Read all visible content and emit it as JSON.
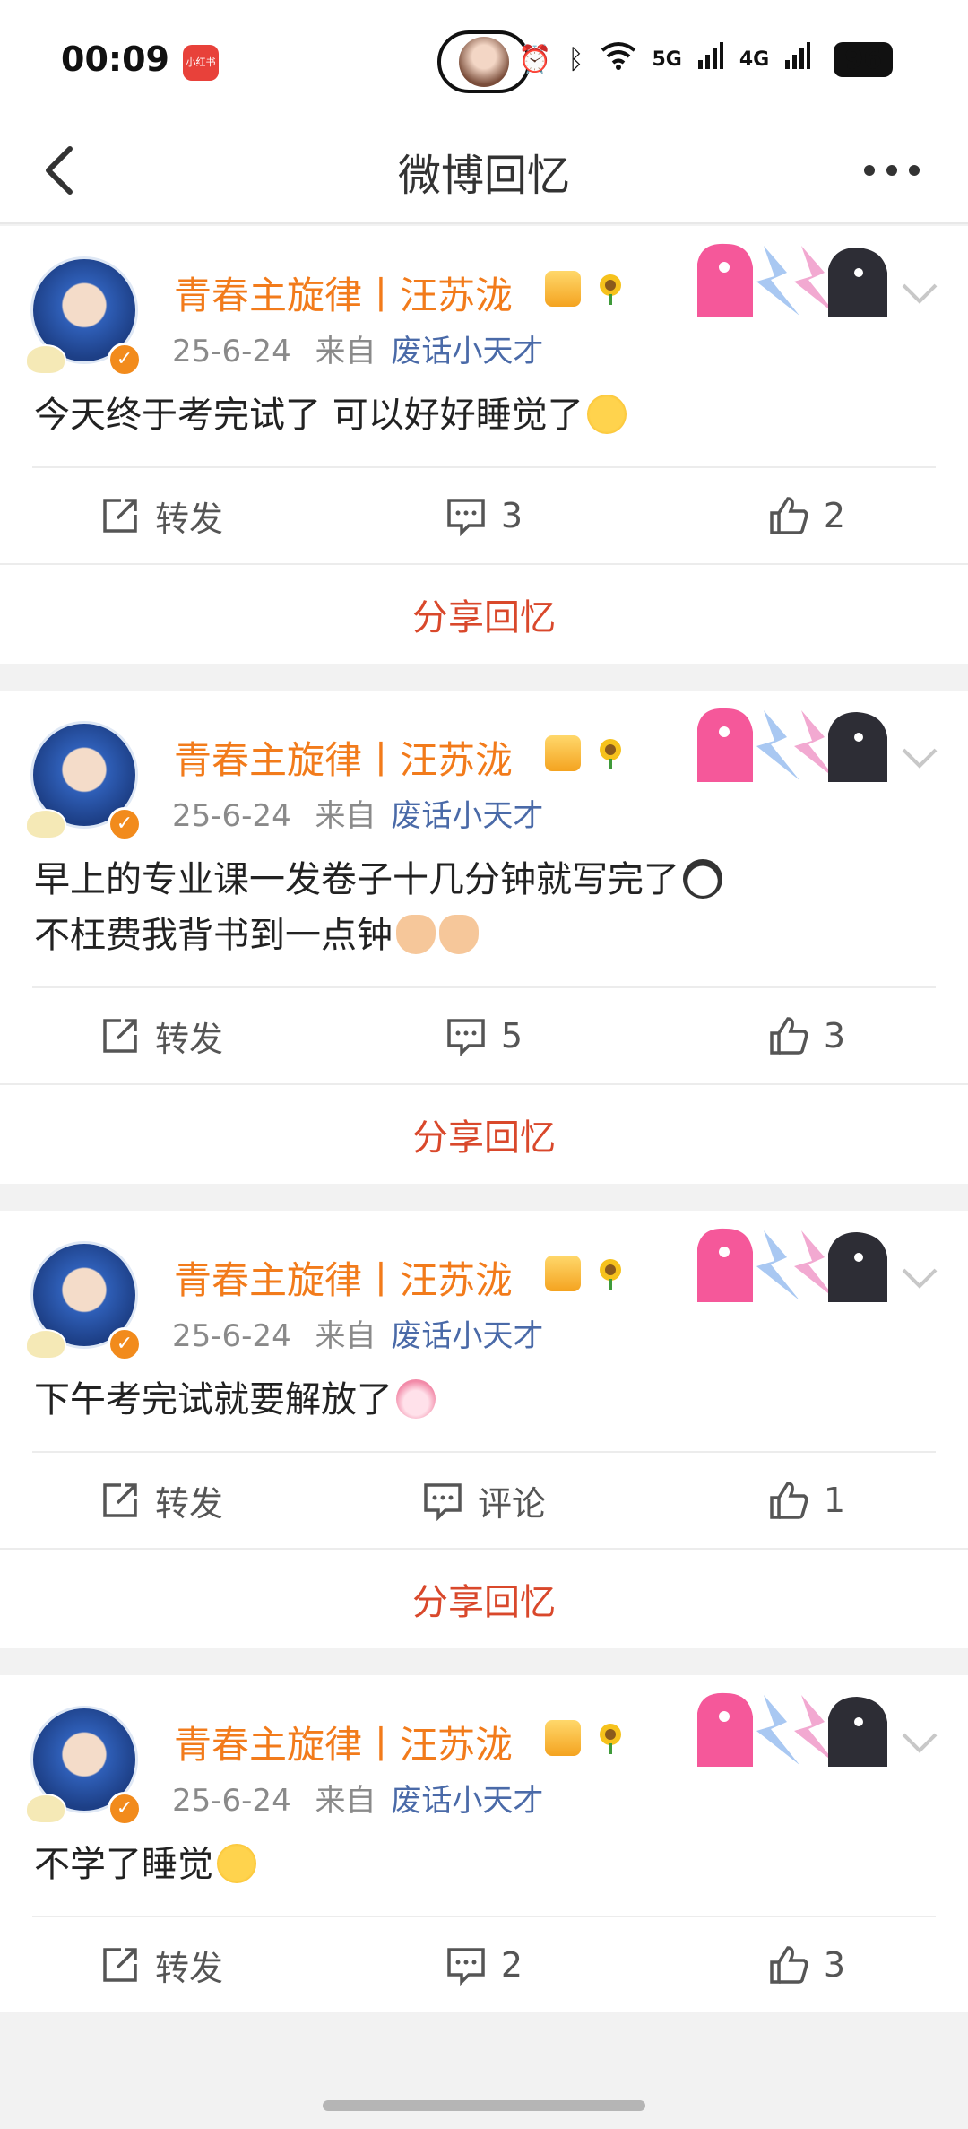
{
  "status_bar": {
    "time": "00:09",
    "app_badge": "小红书",
    "signal_5g": "5G",
    "signal_4g": "4G",
    "battery": "96"
  },
  "nav": {
    "title": "微博回忆"
  },
  "posts": [
    {
      "username": "青春主旋律丨汪苏泷",
      "date": "25-6-24",
      "from_label": "来自",
      "source": "废话小天才",
      "lines": [
        "今天终于考完试了 可以好好睡觉了"
      ],
      "emoji": "cry",
      "repost_label": "转发",
      "comment_label": "3",
      "like_count": "2",
      "share_label": "分享回忆"
    },
    {
      "username": "青春主旋律丨汪苏泷",
      "date": "25-6-24",
      "from_label": "来自",
      "source": "废话小天才",
      "lines": [
        "早上的专业课一发卷子十几分钟就写完了",
        "不枉费我背书到一点钟"
      ],
      "emoji": "panda",
      "repost_label": "转发",
      "comment_label": "5",
      "like_count": "3",
      "share_label": "分享回忆"
    },
    {
      "username": "青春主旋律丨汪苏泷",
      "date": "25-6-24",
      "from_label": "来自",
      "source": "废话小天才",
      "lines": [
        "下午考完试就要解放了"
      ],
      "emoji": "girl",
      "repost_label": "转发",
      "comment_label": "评论",
      "like_count": "1",
      "share_label": "分享回忆"
    },
    {
      "username": "青春主旋律丨汪苏泷",
      "date": "25-6-24",
      "from_label": "来自",
      "source": "废话小天才",
      "lines": [
        "不学了睡觉"
      ],
      "emoji": "sleep",
      "repost_label": "转发",
      "comment_label": "2",
      "like_count": "3",
      "share_label": ""
    }
  ]
}
